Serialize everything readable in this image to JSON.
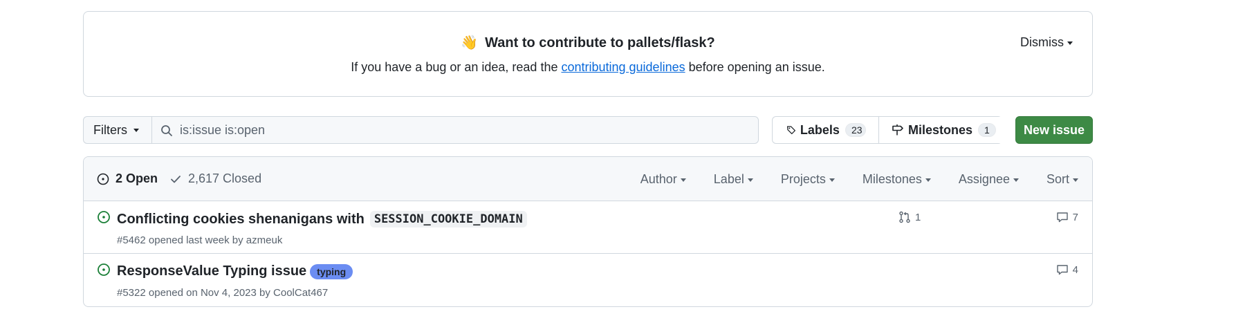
{
  "banner": {
    "emoji": "👋",
    "title": "Want to contribute to pallets/flask?",
    "text_before": "If you have a bug or an idea, read the ",
    "link": "contributing guidelines",
    "text_after": " before opening an issue.",
    "dismiss_label": "Dismiss"
  },
  "toolbar": {
    "filters_label": "Filters",
    "search_value": "is:issue is:open",
    "labels_label": "Labels",
    "labels_count": "23",
    "milestones_label": "Milestones",
    "milestones_count": "1",
    "new_issue_label": "New issue"
  },
  "issues_header": {
    "open_label": "2 Open",
    "closed_label": "2,617 Closed",
    "filters": [
      "Author",
      "Label",
      "Projects",
      "Milestones",
      "Assignee",
      "Sort"
    ]
  },
  "issues": [
    {
      "title": "Conflicting cookies shenanigans with",
      "code": "SESSION_COOKIE_DOMAIN",
      "meta": "#5462 opened last week by azmeuk",
      "linked_prs": "1",
      "comments": "7"
    },
    {
      "title": "ResponseValue Typing issue",
      "label": "typing",
      "label_color": "#6b8df2",
      "meta": "#5322 opened on Nov 4, 2023 by CoolCat467",
      "comments": "4"
    }
  ],
  "colors": {
    "open_icon": "#1a7f37",
    "new_issue_bg": "#3d8a45",
    "link": "#0969da"
  }
}
